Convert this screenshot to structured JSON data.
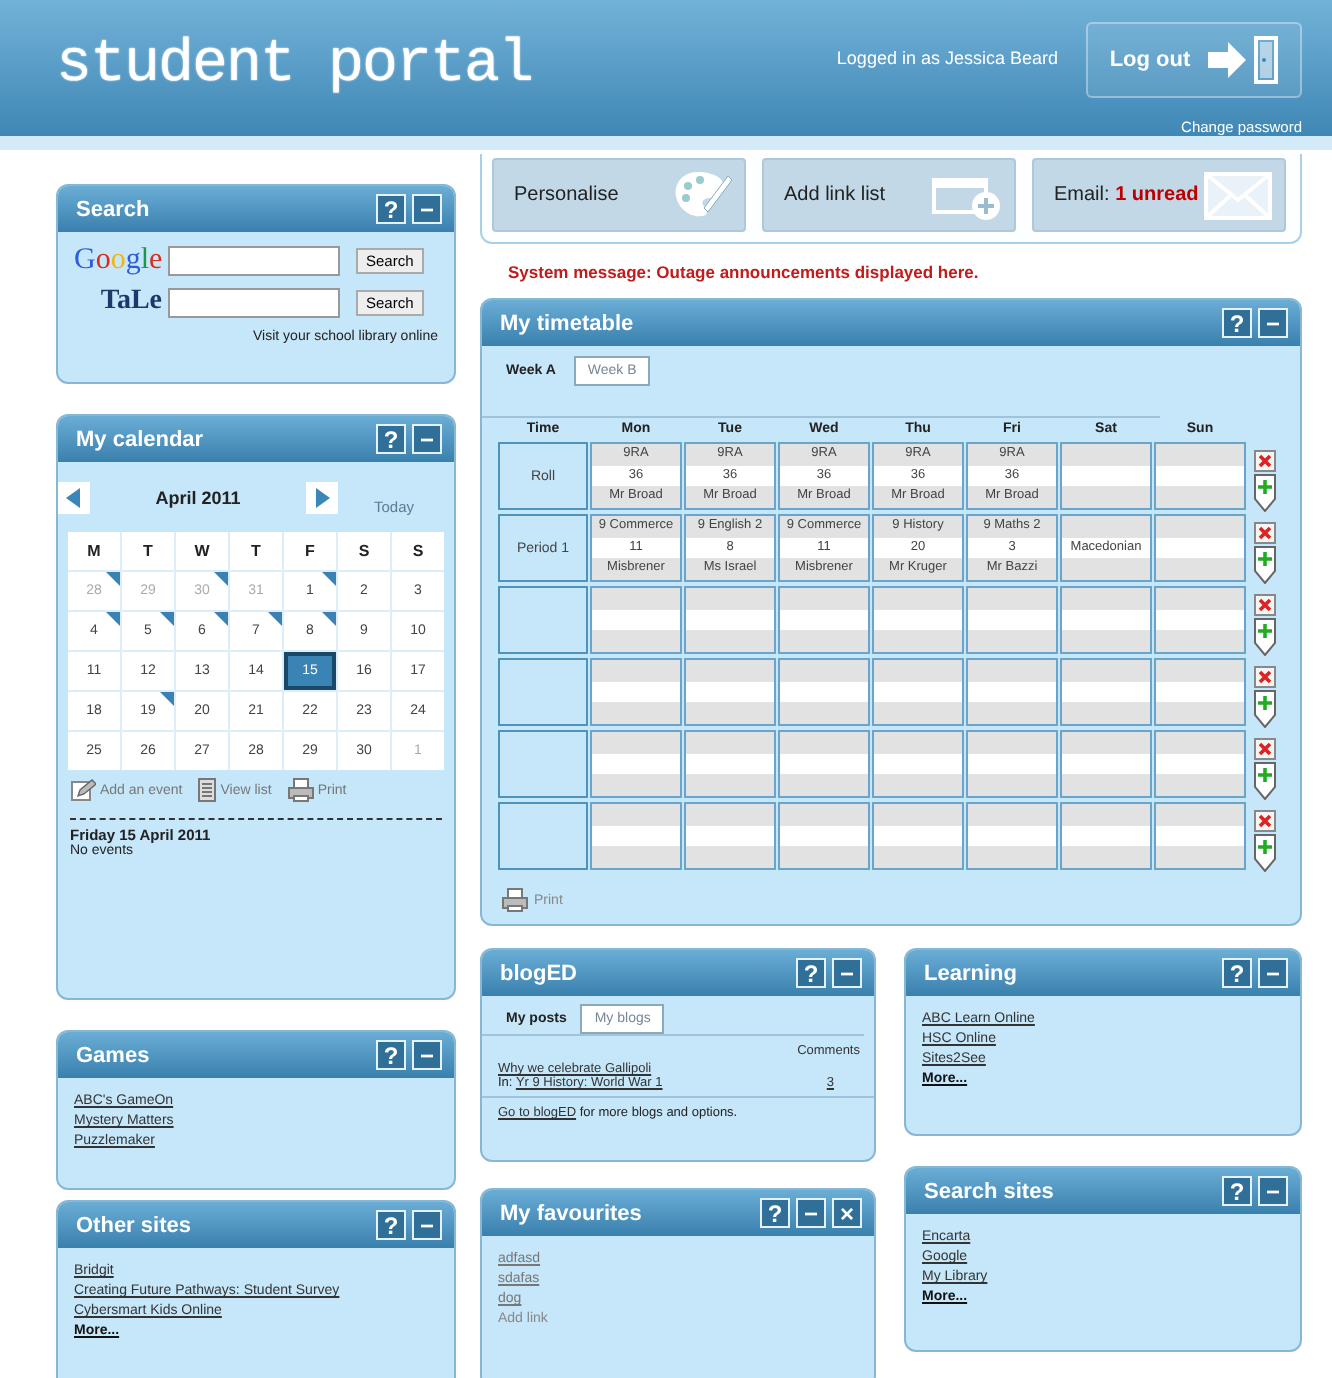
{
  "header": {
    "title": "student portal",
    "logged_in": "Logged in as **Jessica Beard**",
    "logout_button": "Log out",
    "change_password": "Change password"
  },
  "toolbar": [
    {
      "kind": "personalise",
      "label": "Personalise"
    },
    {
      "kind": "add_list",
      "label": "Add link list"
    },
    {
      "kind": "email",
      "label": "Email: **1 unread**"
    }
  ],
  "system_message": "System message: Outage announcements displayed here.",
  "search": {
    "title": "Search",
    "controls": [
      "?",
      "−"
    ],
    "engines": [
      {
        "kind": "google",
        "name": "Google",
        "button": "Search"
      },
      {
        "kind": "tale",
        "name": "TaLe",
        "button": "Search"
      }
    ],
    "library_link": "Visit your school library online"
  },
  "calendar": {
    "title": "My calendar",
    "controls": [
      "?",
      "−"
    ],
    "month": "April 2011",
    "today": "Today",
    "weekdays": [
      "M",
      "T",
      "W",
      "T",
      "F",
      "S",
      "S"
    ],
    "weeks": [
      [
        {
          "day": "28",
          "muted": true,
          "event": true,
          "selected": false
        },
        {
          "day": "29",
          "muted": true,
          "event": false,
          "selected": false
        },
        {
          "day": "30",
          "muted": true,
          "event": true,
          "selected": false
        },
        {
          "day": "31",
          "muted": true,
          "event": false,
          "selected": false
        },
        {
          "day": "1",
          "muted": false,
          "event": true,
          "selected": false
        },
        {
          "day": "2",
          "muted": false,
          "event": false,
          "selected": false
        },
        {
          "day": "3",
          "muted": false,
          "event": false,
          "selected": false
        }
      ],
      [
        {
          "day": "4",
          "muted": false,
          "event": true,
          "selected": false
        },
        {
          "day": "5",
          "muted": false,
          "event": true,
          "selected": false
        },
        {
          "day": "6",
          "muted": false,
          "event": true,
          "selected": false
        },
        {
          "day": "7",
          "muted": false,
          "event": true,
          "selected": false
        },
        {
          "day": "8",
          "muted": false,
          "event": true,
          "selected": false
        },
        {
          "day": "9",
          "muted": false,
          "event": false,
          "selected": false
        },
        {
          "day": "10",
          "muted": false,
          "event": false,
          "selected": false
        }
      ],
      [
        {
          "day": "11",
          "muted": false,
          "event": false,
          "selected": false
        },
        {
          "day": "12",
          "muted": false,
          "event": false,
          "selected": false
        },
        {
          "day": "13",
          "muted": false,
          "event": false,
          "selected": false
        },
        {
          "day": "14",
          "muted": false,
          "event": false,
          "selected": false
        },
        {
          "day": "15",
          "muted": false,
          "event": false,
          "selected": true
        },
        {
          "day": "16",
          "muted": false,
          "event": false,
          "selected": false
        },
        {
          "day": "17",
          "muted": false,
          "event": false,
          "selected": false
        }
      ],
      [
        {
          "day": "18",
          "muted": false,
          "event": false,
          "selected": false
        },
        {
          "day": "19",
          "muted": false,
          "event": true,
          "selected": false
        },
        {
          "day": "20",
          "muted": false,
          "event": false,
          "selected": false
        },
        {
          "day": "21",
          "muted": false,
          "event": false,
          "selected": false
        },
        {
          "day": "22",
          "muted": false,
          "event": false,
          "selected": false
        },
        {
          "day": "23",
          "muted": false,
          "event": false,
          "selected": false
        },
        {
          "day": "24",
          "muted": false,
          "event": false,
          "selected": false
        }
      ],
      [
        {
          "day": "25",
          "muted": false,
          "event": false,
          "selected": false
        },
        {
          "day": "26",
          "muted": false,
          "event": false,
          "selected": false
        },
        {
          "day": "27",
          "muted": false,
          "event": false,
          "selected": false
        },
        {
          "day": "28",
          "muted": false,
          "event": false,
          "selected": false
        },
        {
          "day": "29",
          "muted": false,
          "event": false,
          "selected": false
        },
        {
          "day": "30",
          "muted": false,
          "event": false,
          "selected": false
        },
        {
          "day": "1",
          "muted": true,
          "event": false,
          "selected": false
        }
      ]
    ],
    "actions": [
      {
        "kind": "add",
        "label": "Add an event"
      },
      {
        "kind": "list",
        "label": "View list"
      },
      {
        "kind": "print",
        "label": "Print"
      }
    ],
    "selected_date": "Friday 15 April 2011",
    "events_note": "No events"
  },
  "timetable": {
    "title": "My timetable",
    "controls": [
      "?",
      "−"
    ],
    "tabs": [
      {
        "label": "Week A",
        "selected": true
      },
      {
        "label": "Week B",
        "selected": false
      }
    ],
    "columns": [
      "Time",
      "Mon",
      "Tue",
      "Wed",
      "Thu",
      "Fri",
      "Sat",
      "Sun"
    ],
    "rows": [
      {
        "time": "Roll",
        "cells": [
          {
            "top": "9RA",
            "middle": "36",
            "bottom": "Mr Broad"
          },
          {
            "top": "9RA",
            "middle": "36",
            "bottom": "Mr Broad"
          },
          {
            "top": "9RA",
            "middle": "36",
            "bottom": "Mr Broad"
          },
          {
            "top": "9RA",
            "middle": "36",
            "bottom": "Mr Broad"
          },
          {
            "top": "9RA",
            "middle": "36",
            "bottom": "Mr Broad"
          }
        ]
      },
      {
        "time": "Period 1",
        "cells": [
          {
            "top": "9 Commerce",
            "middle": "11",
            "bottom": "Misbrener"
          },
          {
            "top": "9 English 2",
            "middle": "8",
            "bottom": "Ms Israel"
          },
          {
            "top": "9 Commerce",
            "middle": "11",
            "bottom": "Misbrener"
          },
          {
            "top": "9 History",
            "middle": "20",
            "bottom": "Mr Kruger"
          },
          {
            "top": "9 Maths 2",
            "middle": "3",
            "bottom": "Mr Bazzi"
          },
          {
            "middle": "Macedonian"
          }
        ]
      },
      {},
      {},
      {},
      {}
    ],
    "print": "Print"
  },
  "blog": {
    "title": "blogED",
    "controls": [
      "?",
      "−"
    ],
    "tabs": [
      {
        "label": "My posts",
        "selected": true
      },
      {
        "label": "My blogs",
        "selected": false
      }
    ],
    "comments_heading": "Comments",
    "posts": [
      {
        "title": "Why we celebrate Gallipoli",
        "in_label": "In:",
        "blog": "Yr 9 History: World War 1",
        "comments": "3"
      }
    ],
    "footer_link": "Go to blogED",
    "footer_text": "for more blogs and options."
  },
  "learning": {
    "title": "Learning",
    "controls": [
      "?",
      "−"
    ],
    "links": [
      "ABC Learn Online",
      "HSC Online",
      "Sites2See"
    ],
    "more": "More..."
  },
  "games": {
    "title": "Games",
    "controls": [
      "?",
      "−"
    ],
    "links": [
      "ABC's GameOn",
      "Mystery Matters",
      "Puzzlemaker"
    ]
  },
  "other_sites": {
    "title": "Other sites",
    "controls": [
      "?",
      "−"
    ],
    "links": [
      "Bridgit",
      "Creating Future Pathways: Student Survey",
      "Cybersmart Kids Online"
    ],
    "more": "More..."
  },
  "favourites": {
    "title": "My favourites",
    "controls": [
      "?",
      "−",
      "×"
    ],
    "links": [
      "adfasd",
      "sdafas",
      "dog"
    ],
    "add_link": "Add link"
  },
  "search_sites": {
    "title": "Search sites",
    "controls": [
      "?",
      "−"
    ],
    "links": [
      "Encarta",
      "Google",
      "My Library"
    ],
    "more": "More..."
  }
}
